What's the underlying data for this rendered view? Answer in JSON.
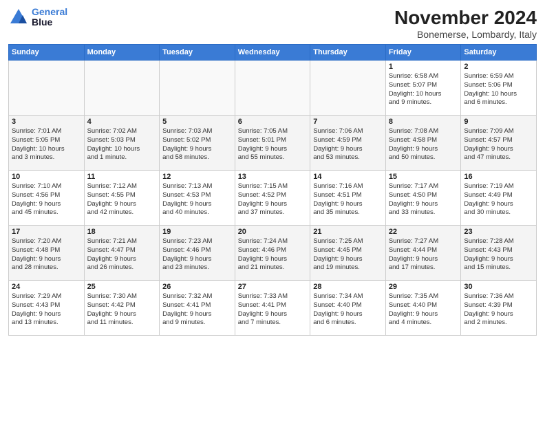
{
  "logo": {
    "line1": "General",
    "line2": "Blue"
  },
  "title": "November 2024",
  "location": "Bonemerse, Lombardy, Italy",
  "weekdays": [
    "Sunday",
    "Monday",
    "Tuesday",
    "Wednesday",
    "Thursday",
    "Friday",
    "Saturday"
  ],
  "weeks": [
    [
      {
        "day": "",
        "info": ""
      },
      {
        "day": "",
        "info": ""
      },
      {
        "day": "",
        "info": ""
      },
      {
        "day": "",
        "info": ""
      },
      {
        "day": "",
        "info": ""
      },
      {
        "day": "1",
        "info": "Sunrise: 6:58 AM\nSunset: 5:07 PM\nDaylight: 10 hours\nand 9 minutes."
      },
      {
        "day": "2",
        "info": "Sunrise: 6:59 AM\nSunset: 5:06 PM\nDaylight: 10 hours\nand 6 minutes."
      }
    ],
    [
      {
        "day": "3",
        "info": "Sunrise: 7:01 AM\nSunset: 5:05 PM\nDaylight: 10 hours\nand 3 minutes."
      },
      {
        "day": "4",
        "info": "Sunrise: 7:02 AM\nSunset: 5:03 PM\nDaylight: 10 hours\nand 1 minute."
      },
      {
        "day": "5",
        "info": "Sunrise: 7:03 AM\nSunset: 5:02 PM\nDaylight: 9 hours\nand 58 minutes."
      },
      {
        "day": "6",
        "info": "Sunrise: 7:05 AM\nSunset: 5:01 PM\nDaylight: 9 hours\nand 55 minutes."
      },
      {
        "day": "7",
        "info": "Sunrise: 7:06 AM\nSunset: 4:59 PM\nDaylight: 9 hours\nand 53 minutes."
      },
      {
        "day": "8",
        "info": "Sunrise: 7:08 AM\nSunset: 4:58 PM\nDaylight: 9 hours\nand 50 minutes."
      },
      {
        "day": "9",
        "info": "Sunrise: 7:09 AM\nSunset: 4:57 PM\nDaylight: 9 hours\nand 47 minutes."
      }
    ],
    [
      {
        "day": "10",
        "info": "Sunrise: 7:10 AM\nSunset: 4:56 PM\nDaylight: 9 hours\nand 45 minutes."
      },
      {
        "day": "11",
        "info": "Sunrise: 7:12 AM\nSunset: 4:55 PM\nDaylight: 9 hours\nand 42 minutes."
      },
      {
        "day": "12",
        "info": "Sunrise: 7:13 AM\nSunset: 4:53 PM\nDaylight: 9 hours\nand 40 minutes."
      },
      {
        "day": "13",
        "info": "Sunrise: 7:15 AM\nSunset: 4:52 PM\nDaylight: 9 hours\nand 37 minutes."
      },
      {
        "day": "14",
        "info": "Sunrise: 7:16 AM\nSunset: 4:51 PM\nDaylight: 9 hours\nand 35 minutes."
      },
      {
        "day": "15",
        "info": "Sunrise: 7:17 AM\nSunset: 4:50 PM\nDaylight: 9 hours\nand 33 minutes."
      },
      {
        "day": "16",
        "info": "Sunrise: 7:19 AM\nSunset: 4:49 PM\nDaylight: 9 hours\nand 30 minutes."
      }
    ],
    [
      {
        "day": "17",
        "info": "Sunrise: 7:20 AM\nSunset: 4:48 PM\nDaylight: 9 hours\nand 28 minutes."
      },
      {
        "day": "18",
        "info": "Sunrise: 7:21 AM\nSunset: 4:47 PM\nDaylight: 9 hours\nand 26 minutes."
      },
      {
        "day": "19",
        "info": "Sunrise: 7:23 AM\nSunset: 4:46 PM\nDaylight: 9 hours\nand 23 minutes."
      },
      {
        "day": "20",
        "info": "Sunrise: 7:24 AM\nSunset: 4:46 PM\nDaylight: 9 hours\nand 21 minutes."
      },
      {
        "day": "21",
        "info": "Sunrise: 7:25 AM\nSunset: 4:45 PM\nDaylight: 9 hours\nand 19 minutes."
      },
      {
        "day": "22",
        "info": "Sunrise: 7:27 AM\nSunset: 4:44 PM\nDaylight: 9 hours\nand 17 minutes."
      },
      {
        "day": "23",
        "info": "Sunrise: 7:28 AM\nSunset: 4:43 PM\nDaylight: 9 hours\nand 15 minutes."
      }
    ],
    [
      {
        "day": "24",
        "info": "Sunrise: 7:29 AM\nSunset: 4:43 PM\nDaylight: 9 hours\nand 13 minutes."
      },
      {
        "day": "25",
        "info": "Sunrise: 7:30 AM\nSunset: 4:42 PM\nDaylight: 9 hours\nand 11 minutes."
      },
      {
        "day": "26",
        "info": "Sunrise: 7:32 AM\nSunset: 4:41 PM\nDaylight: 9 hours\nand 9 minutes."
      },
      {
        "day": "27",
        "info": "Sunrise: 7:33 AM\nSunset: 4:41 PM\nDaylight: 9 hours\nand 7 minutes."
      },
      {
        "day": "28",
        "info": "Sunrise: 7:34 AM\nSunset: 4:40 PM\nDaylight: 9 hours\nand 6 minutes."
      },
      {
        "day": "29",
        "info": "Sunrise: 7:35 AM\nSunset: 4:40 PM\nDaylight: 9 hours\nand 4 minutes."
      },
      {
        "day": "30",
        "info": "Sunrise: 7:36 AM\nSunset: 4:39 PM\nDaylight: 9 hours\nand 2 minutes."
      }
    ]
  ]
}
